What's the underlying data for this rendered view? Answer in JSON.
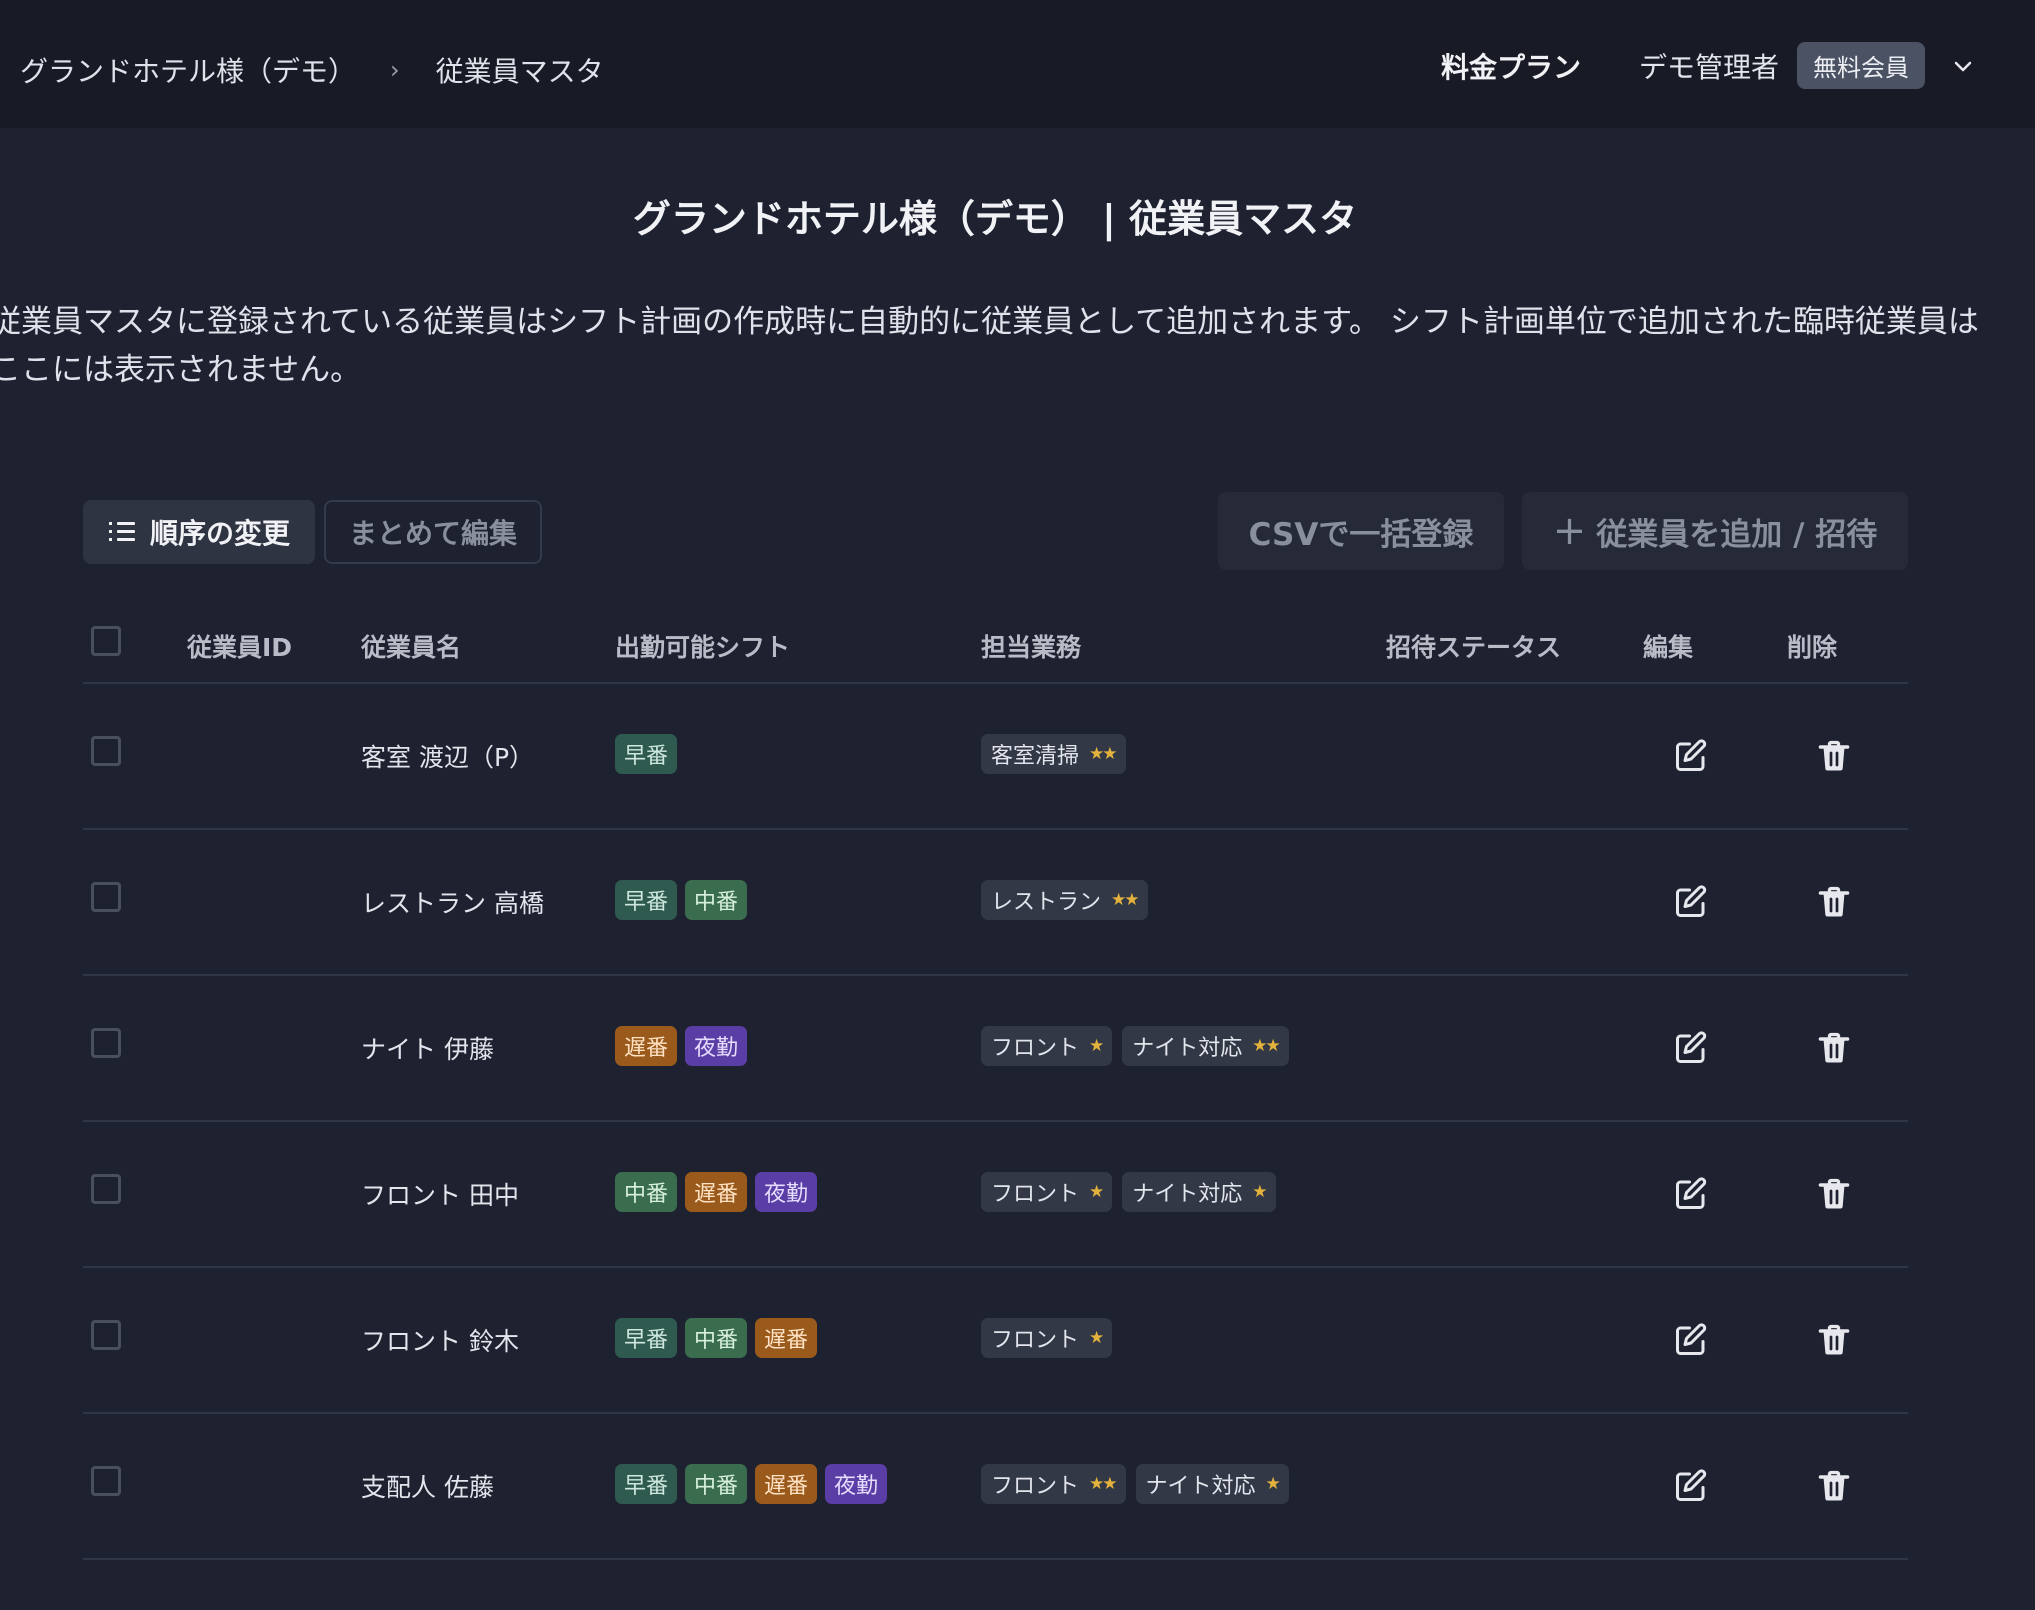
{
  "breadcrumb": {
    "hotel": "グランドホテル様（デモ）",
    "separator": "›",
    "page": "従業員マスタ"
  },
  "header": {
    "pricing": "料金プラン",
    "user": "デモ管理者",
    "member_badge": "無料会員"
  },
  "page": {
    "title": "グランドホテル様（デモ） | 従業員マスタ",
    "description": "従業員マスタに登録されている従業員はシフト計画の作成時に自動的に従業員として追加されます。 シフト計画単位で追加された臨時従業員はここには表示されません。"
  },
  "toolbar": {
    "reorder": "順序の変更",
    "bulk_edit": "まとめて編集",
    "csv_import": "CSVで一括登録",
    "add_plus": "+",
    "add_invite": "従業員を追加 / 招待"
  },
  "table": {
    "columns": {
      "id": "従業員ID",
      "name": "従業員名",
      "shifts": "出勤可能シフト",
      "duties": "担当業務",
      "invite_status": "招待ステータス",
      "edit": "編集",
      "delete": "削除"
    },
    "rows": [
      {
        "name": "客室 渡辺（P）",
        "shifts": [
          {
            "label": "早番",
            "kind": "early"
          }
        ],
        "duties": [
          {
            "label": "客室清掃",
            "stars": "★★"
          }
        ]
      },
      {
        "name": "レストラン 高橋",
        "shifts": [
          {
            "label": "早番",
            "kind": "early"
          },
          {
            "label": "中番",
            "kind": "mid"
          }
        ],
        "duties": [
          {
            "label": "レストラン",
            "stars": "★★"
          }
        ]
      },
      {
        "name": "ナイト 伊藤",
        "shifts": [
          {
            "label": "遅番",
            "kind": "late"
          },
          {
            "label": "夜勤",
            "kind": "night"
          }
        ],
        "duties": [
          {
            "label": "フロント",
            "stars": "★"
          },
          {
            "label": "ナイト対応",
            "stars": "★★"
          }
        ]
      },
      {
        "name": "フロント 田中",
        "shifts": [
          {
            "label": "中番",
            "kind": "mid"
          },
          {
            "label": "遅番",
            "kind": "late"
          },
          {
            "label": "夜勤",
            "kind": "night"
          }
        ],
        "duties": [
          {
            "label": "フロント",
            "stars": "★"
          },
          {
            "label": "ナイト対応",
            "stars": "★"
          }
        ]
      },
      {
        "name": "フロント 鈴木",
        "shifts": [
          {
            "label": "早番",
            "kind": "early"
          },
          {
            "label": "中番",
            "kind": "mid"
          },
          {
            "label": "遅番",
            "kind": "late"
          }
        ],
        "duties": [
          {
            "label": "フロント",
            "stars": "★"
          }
        ]
      },
      {
        "name": "支配人 佐藤",
        "shifts": [
          {
            "label": "早番",
            "kind": "early"
          },
          {
            "label": "中番",
            "kind": "mid"
          },
          {
            "label": "遅番",
            "kind": "late"
          },
          {
            "label": "夜勤",
            "kind": "night"
          }
        ],
        "duties": [
          {
            "label": "フロント",
            "stars": "★★"
          },
          {
            "label": "ナイト対応",
            "stars": "★"
          }
        ]
      }
    ]
  },
  "colors": {
    "background": "#1e2230",
    "topbar": "#181b26",
    "star": "#e2b23c",
    "shift_early": "#2f5a4f",
    "shift_mid": "#3a6d4e",
    "shift_late": "#9a5a1c",
    "shift_night": "#5a3ea6"
  },
  "icons": {
    "reorder": "list-ordered-icon",
    "dropdown": "chevron-down-icon",
    "edit": "edit-icon",
    "delete": "trash-icon"
  }
}
